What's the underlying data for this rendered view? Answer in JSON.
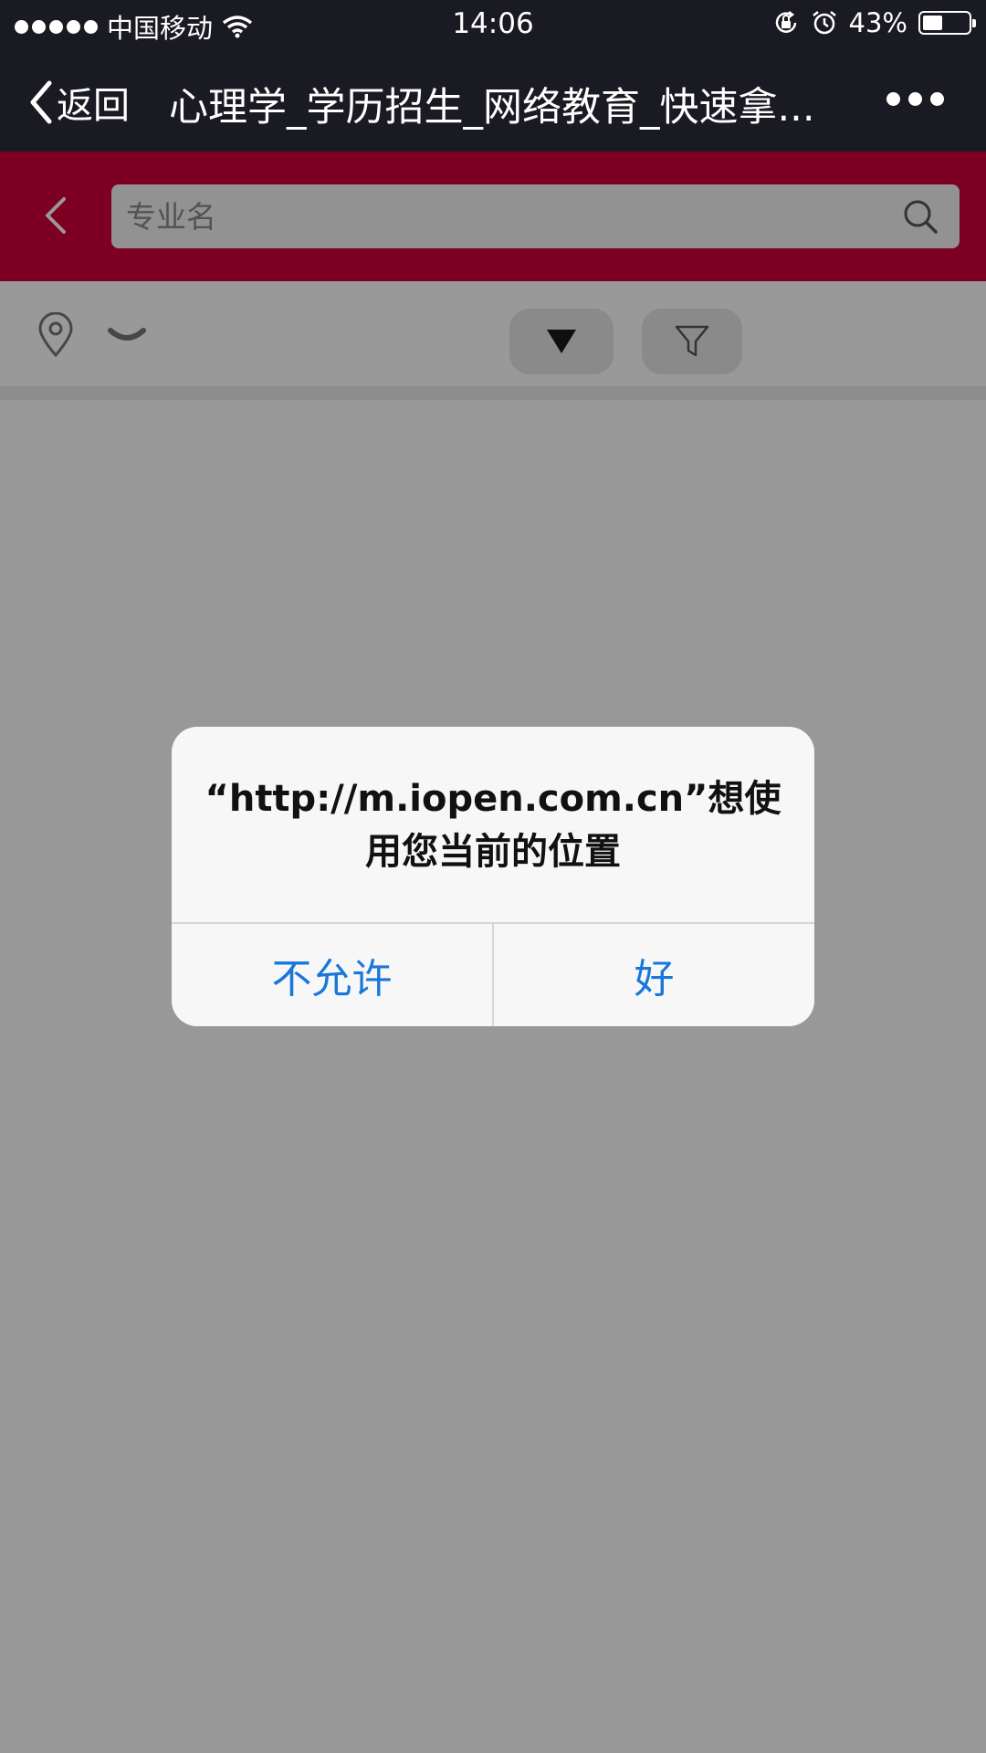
{
  "status_bar": {
    "carrier": "中国移动",
    "time": "14:06",
    "battery_text": "43%",
    "battery_level": 0.43
  },
  "nav": {
    "back_label": "返回",
    "title": "心理学_学历招生_网络教育_快速拿..."
  },
  "search": {
    "placeholder": "专业名"
  },
  "alert": {
    "message_line1": "“http://m.iopen.com.cn”想使",
    "message_line2": "用您当前的位置",
    "deny_label": "不允许",
    "allow_label": "好"
  },
  "colors": {
    "brand": "#d1003a",
    "nav_background": "#1a1a22",
    "alert_button_text": "#1877d8"
  },
  "icons": [
    "chevron-left-icon",
    "wifi-icon",
    "orientation-lock-icon",
    "alarm-icon",
    "battery-icon",
    "more-icon",
    "search-icon",
    "location-pin-icon",
    "chevron-down-icon",
    "triangle-down-icon",
    "filter-icon"
  ]
}
